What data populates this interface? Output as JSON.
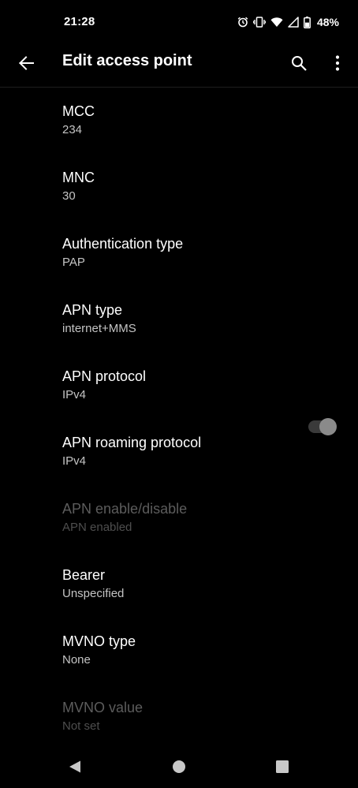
{
  "status_bar": {
    "time": "21:28",
    "battery_percent": "48%",
    "icons": [
      "alarm-icon",
      "vibrate-icon",
      "wifi-icon",
      "cell-signal-icon",
      "battery-icon"
    ]
  },
  "app_bar": {
    "title": "Edit access point",
    "icons": [
      "back-arrow-icon",
      "search-icon",
      "more-vert-icon"
    ]
  },
  "preferences": [
    {
      "title": "MCC",
      "summary": "234",
      "enabled": true
    },
    {
      "title": "MNC",
      "summary": "30",
      "enabled": true
    },
    {
      "title": "Authentication type",
      "summary": "PAP",
      "enabled": true
    },
    {
      "title": "APN type",
      "summary": "internet+MMS",
      "enabled": true
    },
    {
      "title": "APN protocol",
      "summary": "IPv4",
      "enabled": true
    },
    {
      "title": "APN roaming protocol",
      "summary": "IPv4",
      "enabled": true
    },
    {
      "title": "APN enable/disable",
      "summary": "APN enabled",
      "enabled": false,
      "toggle_on": true
    },
    {
      "title": "Bearer",
      "summary": "Unspecified",
      "enabled": true
    },
    {
      "title": "MVNO type",
      "summary": "None",
      "enabled": true
    },
    {
      "title": "MVNO value",
      "summary": "Not set",
      "enabled": false
    }
  ],
  "nav_bar": {
    "icons": [
      "nav-back-icon",
      "nav-home-icon",
      "nav-recents-icon"
    ]
  },
  "colors": {
    "background": "#000000",
    "primary_text": "#ffffff",
    "secondary_text": "#c4c4c4",
    "disabled_text": "#5c5c5c"
  }
}
